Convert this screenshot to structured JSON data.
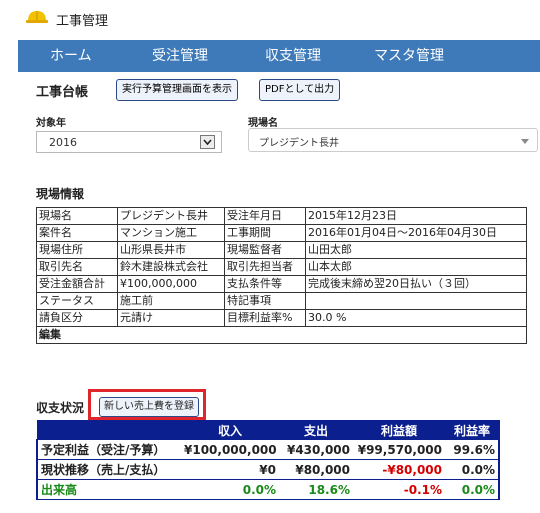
{
  "app": {
    "title": "工事管理"
  },
  "nav": {
    "items": [
      "ホーム",
      "受注管理",
      "収支管理",
      "マスタ管理"
    ]
  },
  "page": {
    "title": "工事台帳",
    "btn_budget": "実行予算管理画面を表示",
    "btn_pdf": "PDFとして出力"
  },
  "filters": {
    "year_label": "対象年",
    "year_value": "2016",
    "site_label": "現場名",
    "site_value": "プレジデント長井"
  },
  "site_info": {
    "title": "現場情報",
    "rows": [
      [
        "現場名",
        "プレジデント長井",
        "受注年月日",
        "2015年12月23日"
      ],
      [
        "案件名",
        "マンション施工",
        "工事期間",
        "2016年01月04日～2016年04月30日"
      ],
      [
        "現場住所",
        "山形県長井市",
        "現場監督者",
        "山田太郎"
      ],
      [
        "取引先名",
        "鈴木建設株式会社",
        "取引先担当者",
        "山本太郎"
      ],
      [
        "受注金額合計",
        "¥100,000,000",
        "支払条件等",
        "完成後末締め翌20日払い（３回）"
      ],
      [
        "ステータス",
        "施工前",
        "特記事項",
        ""
      ],
      [
        "請負区分",
        "元請け",
        "目標利益率%",
        "30.0 %"
      ]
    ],
    "edit_label": "編集"
  },
  "pl": {
    "title": "収支状況",
    "new_button": "新しい売上費を登録",
    "headers": [
      "",
      "収入",
      "支出",
      "利益額",
      "利益率"
    ],
    "rows": [
      {
        "label": "予定利益（受注/予算）",
        "cells": [
          "¥100,000,000",
          "¥430,000",
          "¥99,570,000",
          "99.6%"
        ]
      },
      {
        "label": "現状推移（売上/支払）",
        "cells": [
          "¥0",
          "¥80,000",
          "-¥80,000",
          "0.0%"
        ]
      },
      {
        "label": "出来高",
        "cells": [
          "0.0%",
          "18.6%",
          "-0.1%",
          "0.0%"
        ]
      }
    ]
  },
  "colors": {
    "nav_bg": "#3e7ab9",
    "table_header": "#0b1f8e",
    "highlight": "#e0262d",
    "negative": "#d40000",
    "positive": "#1a8a1a"
  }
}
